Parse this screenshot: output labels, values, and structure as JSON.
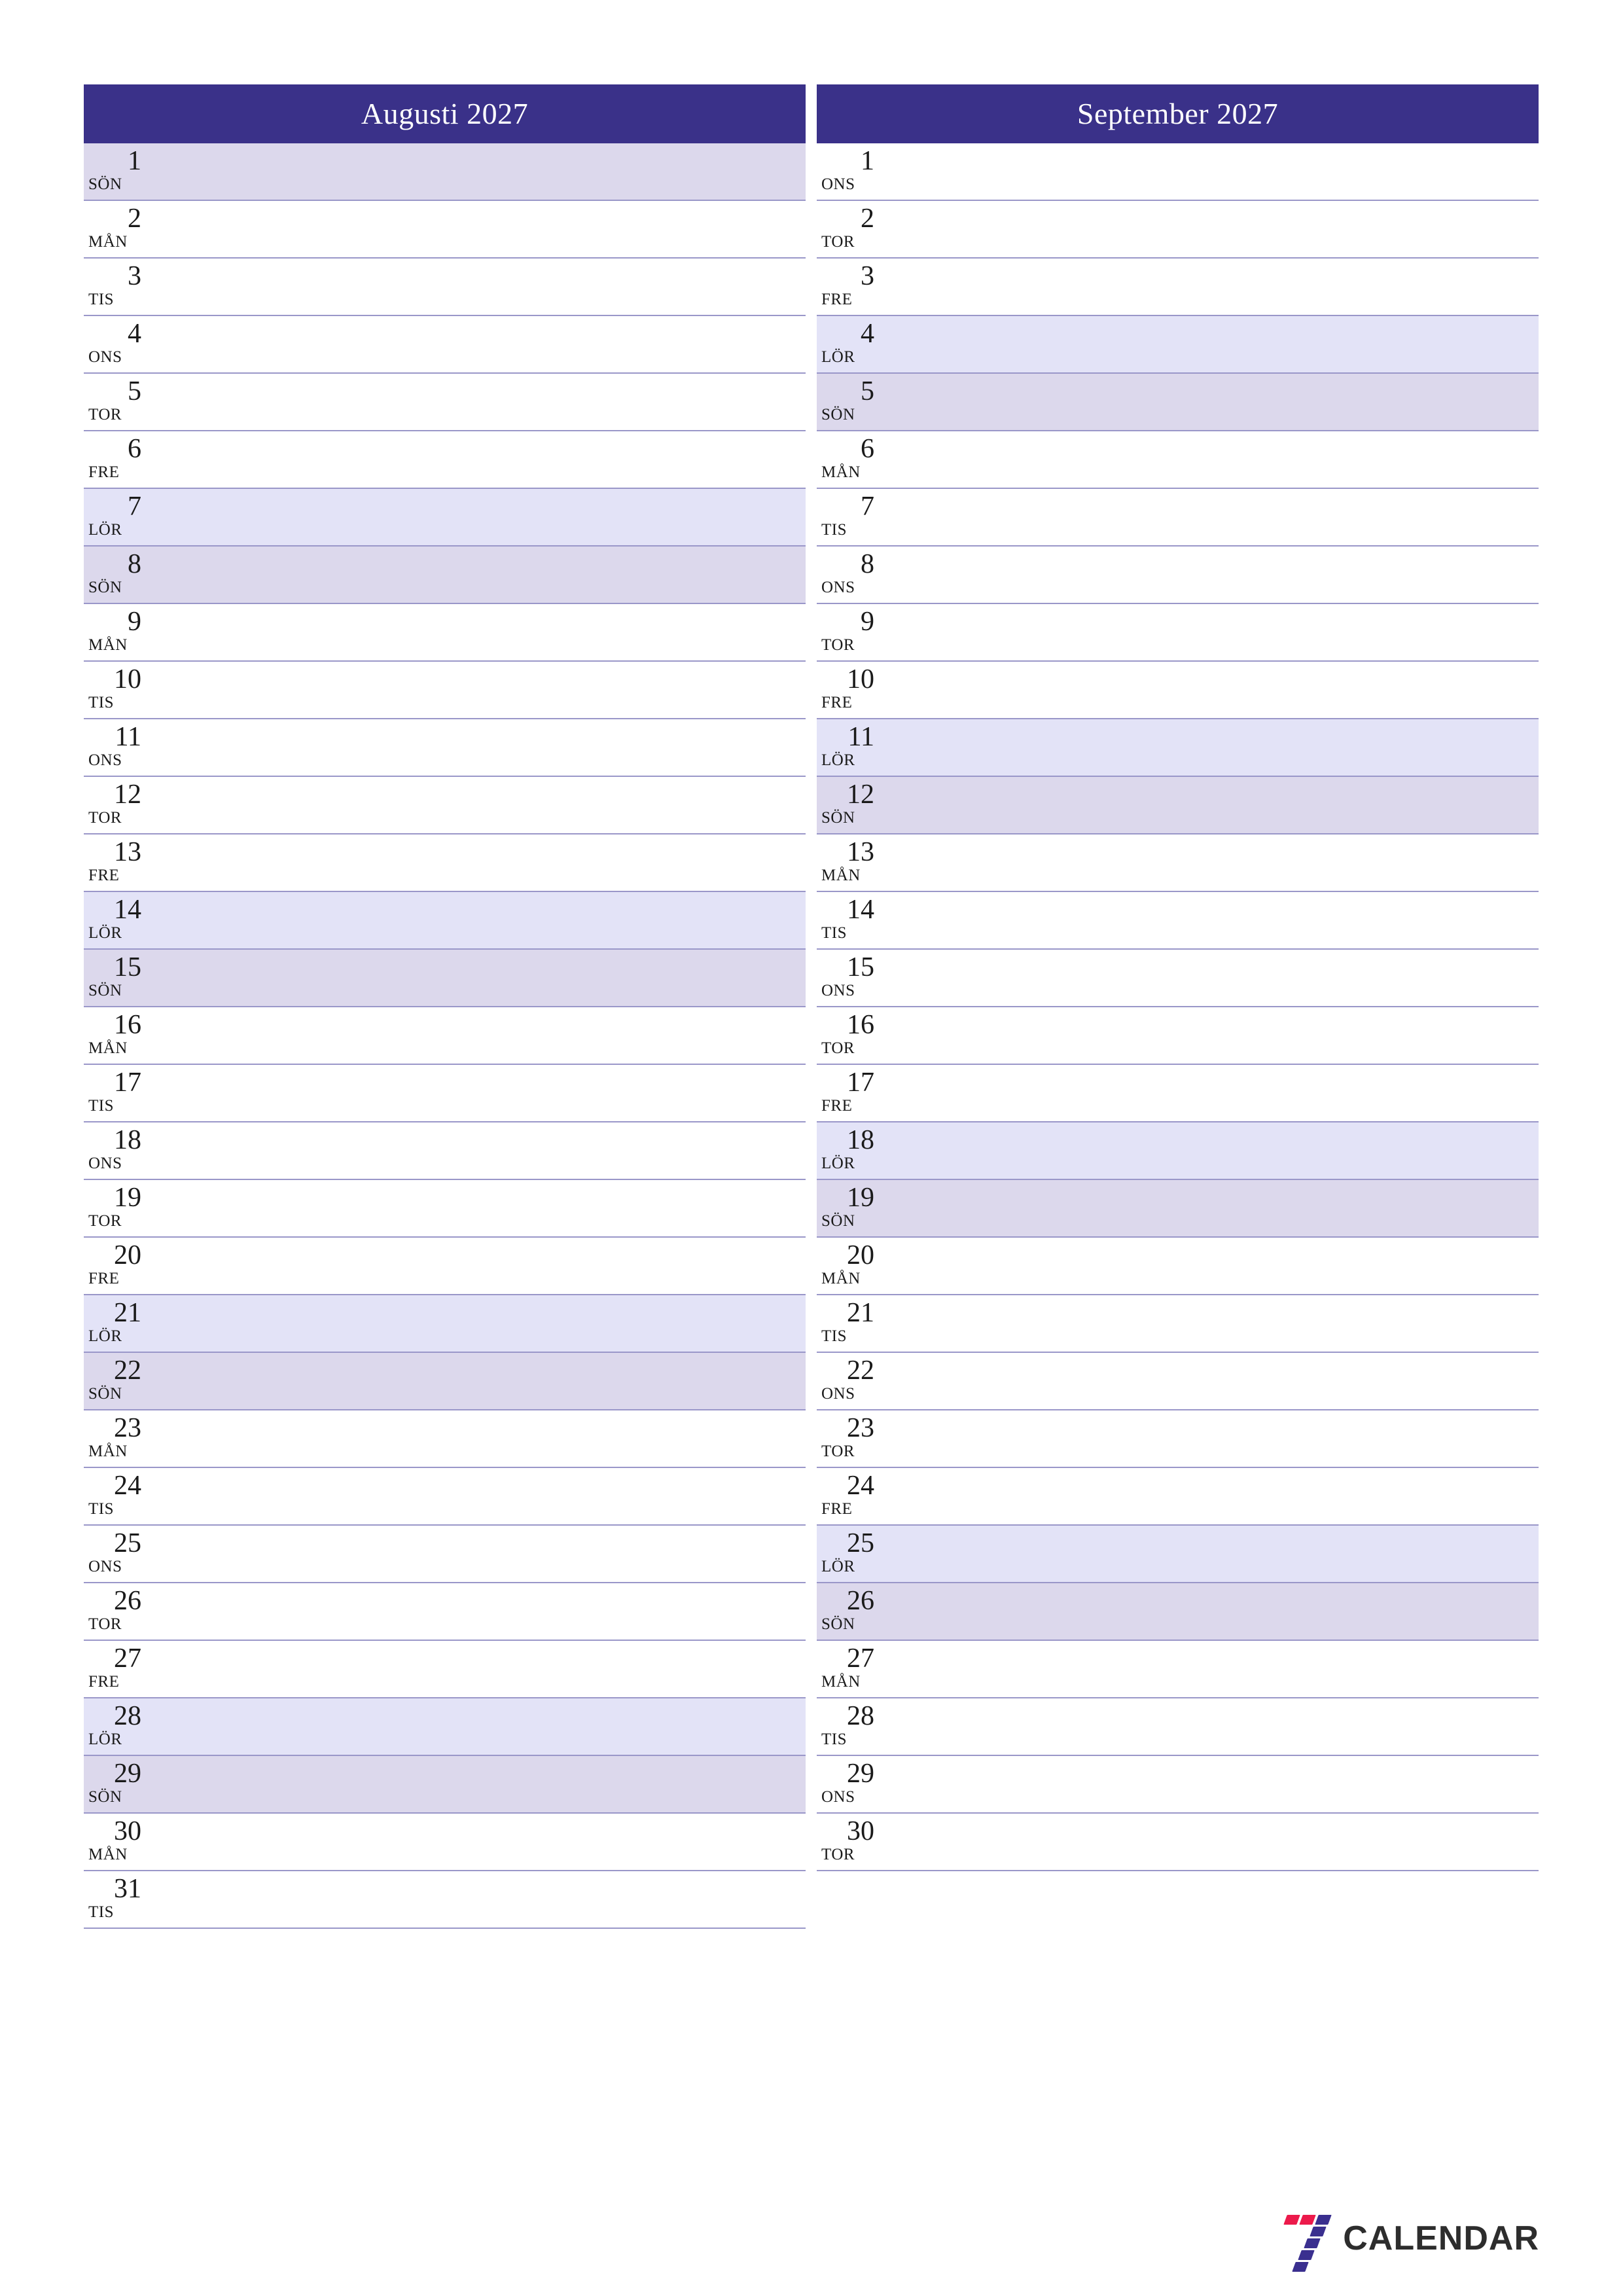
{
  "document": {
    "type": "monthly-planner",
    "language": "sv",
    "year": "2027",
    "page_background": "#ffffff"
  },
  "colors": {
    "header_bg": "#3a3189",
    "header_text": "#ffffff",
    "row_border": "#9a97c9",
    "saturday_bg": "#e3e3f7",
    "sunday_bg": "#dcd8ec",
    "weekday_bg": "#ffffff",
    "text": "#1a1a1a",
    "logo_red": "#ec1a4b",
    "logo_blue": "#3a2f8f",
    "logo_text": "#2d2d2d"
  },
  "months": [
    {
      "title": "Augusti 2027",
      "name": "Augusti",
      "days": [
        {
          "num": "1",
          "dow": "SÖN",
          "type": "sun"
        },
        {
          "num": "2",
          "dow": "MÅN",
          "type": "weekday"
        },
        {
          "num": "3",
          "dow": "TIS",
          "type": "weekday"
        },
        {
          "num": "4",
          "dow": "ONS",
          "type": "weekday"
        },
        {
          "num": "5",
          "dow": "TOR",
          "type": "weekday"
        },
        {
          "num": "6",
          "dow": "FRE",
          "type": "weekday"
        },
        {
          "num": "7",
          "dow": "LÖR",
          "type": "sat"
        },
        {
          "num": "8",
          "dow": "SÖN",
          "type": "sun"
        },
        {
          "num": "9",
          "dow": "MÅN",
          "type": "weekday"
        },
        {
          "num": "10",
          "dow": "TIS",
          "type": "weekday"
        },
        {
          "num": "11",
          "dow": "ONS",
          "type": "weekday"
        },
        {
          "num": "12",
          "dow": "TOR",
          "type": "weekday"
        },
        {
          "num": "13",
          "dow": "FRE",
          "type": "weekday"
        },
        {
          "num": "14",
          "dow": "LÖR",
          "type": "sat"
        },
        {
          "num": "15",
          "dow": "SÖN",
          "type": "sun"
        },
        {
          "num": "16",
          "dow": "MÅN",
          "type": "weekday"
        },
        {
          "num": "17",
          "dow": "TIS",
          "type": "weekday"
        },
        {
          "num": "18",
          "dow": "ONS",
          "type": "weekday"
        },
        {
          "num": "19",
          "dow": "TOR",
          "type": "weekday"
        },
        {
          "num": "20",
          "dow": "FRE",
          "type": "weekday"
        },
        {
          "num": "21",
          "dow": "LÖR",
          "type": "sat"
        },
        {
          "num": "22",
          "dow": "SÖN",
          "type": "sun"
        },
        {
          "num": "23",
          "dow": "MÅN",
          "type": "weekday"
        },
        {
          "num": "24",
          "dow": "TIS",
          "type": "weekday"
        },
        {
          "num": "25",
          "dow": "ONS",
          "type": "weekday"
        },
        {
          "num": "26",
          "dow": "TOR",
          "type": "weekday"
        },
        {
          "num": "27",
          "dow": "FRE",
          "type": "weekday"
        },
        {
          "num": "28",
          "dow": "LÖR",
          "type": "sat"
        },
        {
          "num": "29",
          "dow": "SÖN",
          "type": "sun"
        },
        {
          "num": "30",
          "dow": "MÅN",
          "type": "weekday"
        },
        {
          "num": "31",
          "dow": "TIS",
          "type": "weekday"
        }
      ]
    },
    {
      "title": "September 2027",
      "name": "September",
      "days": [
        {
          "num": "1",
          "dow": "ONS",
          "type": "weekday"
        },
        {
          "num": "2",
          "dow": "TOR",
          "type": "weekday"
        },
        {
          "num": "3",
          "dow": "FRE",
          "type": "weekday"
        },
        {
          "num": "4",
          "dow": "LÖR",
          "type": "sat"
        },
        {
          "num": "5",
          "dow": "SÖN",
          "type": "sun"
        },
        {
          "num": "6",
          "dow": "MÅN",
          "type": "weekday"
        },
        {
          "num": "7",
          "dow": "TIS",
          "type": "weekday"
        },
        {
          "num": "8",
          "dow": "ONS",
          "type": "weekday"
        },
        {
          "num": "9",
          "dow": "TOR",
          "type": "weekday"
        },
        {
          "num": "10",
          "dow": "FRE",
          "type": "weekday"
        },
        {
          "num": "11",
          "dow": "LÖR",
          "type": "sat"
        },
        {
          "num": "12",
          "dow": "SÖN",
          "type": "sun"
        },
        {
          "num": "13",
          "dow": "MÅN",
          "type": "weekday"
        },
        {
          "num": "14",
          "dow": "TIS",
          "type": "weekday"
        },
        {
          "num": "15",
          "dow": "ONS",
          "type": "weekday"
        },
        {
          "num": "16",
          "dow": "TOR",
          "type": "weekday"
        },
        {
          "num": "17",
          "dow": "FRE",
          "type": "weekday"
        },
        {
          "num": "18",
          "dow": "LÖR",
          "type": "sat"
        },
        {
          "num": "19",
          "dow": "SÖN",
          "type": "sun"
        },
        {
          "num": "20",
          "dow": "MÅN",
          "type": "weekday"
        },
        {
          "num": "21",
          "dow": "TIS",
          "type": "weekday"
        },
        {
          "num": "22",
          "dow": "ONS",
          "type": "weekday"
        },
        {
          "num": "23",
          "dow": "TOR",
          "type": "weekday"
        },
        {
          "num": "24",
          "dow": "FRE",
          "type": "weekday"
        },
        {
          "num": "25",
          "dow": "LÖR",
          "type": "sat"
        },
        {
          "num": "26",
          "dow": "SÖN",
          "type": "sun"
        },
        {
          "num": "27",
          "dow": "MÅN",
          "type": "weekday"
        },
        {
          "num": "28",
          "dow": "TIS",
          "type": "weekday"
        },
        {
          "num": "29",
          "dow": "ONS",
          "type": "weekday"
        },
        {
          "num": "30",
          "dow": "TOR",
          "type": "weekday"
        }
      ]
    }
  ],
  "logo": {
    "mark": "seven-blocks-icon",
    "text": "CALENDAR"
  }
}
